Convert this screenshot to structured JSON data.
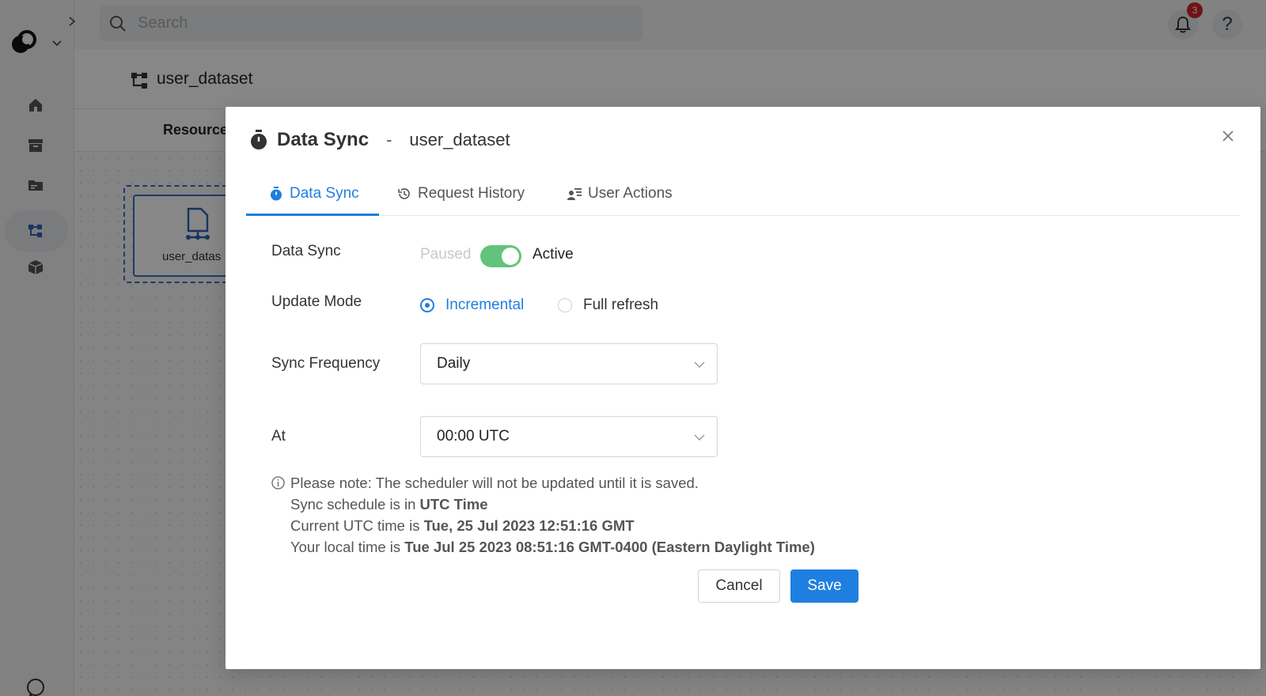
{
  "app": {
    "search_placeholder": "Search",
    "notification_count": "3",
    "help_label": "?",
    "page_title": "user_dataset",
    "tabstrip_label": "Resource",
    "node_label": "user_datas"
  },
  "modal": {
    "title": "Data Sync",
    "separator": "-",
    "subtitle": "user_dataset",
    "tabs": [
      {
        "label": "Data Sync",
        "icon": "stopwatch-icon",
        "active": true
      },
      {
        "label": "Request History",
        "icon": "history-icon",
        "active": false
      },
      {
        "label": "User Actions",
        "icon": "user-list-icon",
        "active": false
      }
    ],
    "data_sync": {
      "label": "Data Sync",
      "paused_label": "Paused",
      "active_label": "Active",
      "enabled": true
    },
    "update_mode": {
      "label": "Update Mode",
      "options": [
        "Incremental",
        "Full refresh"
      ],
      "selected": "Incremental"
    },
    "sync_frequency": {
      "label": "Sync Frequency",
      "value": "Daily"
    },
    "at": {
      "label": "At",
      "value": "00:00 UTC"
    },
    "note": {
      "line1": "Please note: The scheduler will not be updated until it is saved.",
      "line2_prefix": "Sync schedule is in ",
      "line2_bold": "UTC Time",
      "line3_prefix": "Current UTC time is ",
      "line3_bold": "Tue, 25 Jul 2023 12:51:16 GMT",
      "line4_prefix": "Your local time is ",
      "line4_bold": "Tue Jul 25 2023 08:51:16 GMT-0400 (Eastern Daylight Time)"
    },
    "cancel_label": "Cancel",
    "save_label": "Save"
  },
  "colors": {
    "accent": "#1f7fe0",
    "toggle_on": "#62c37c",
    "badge": "#d4242c"
  }
}
